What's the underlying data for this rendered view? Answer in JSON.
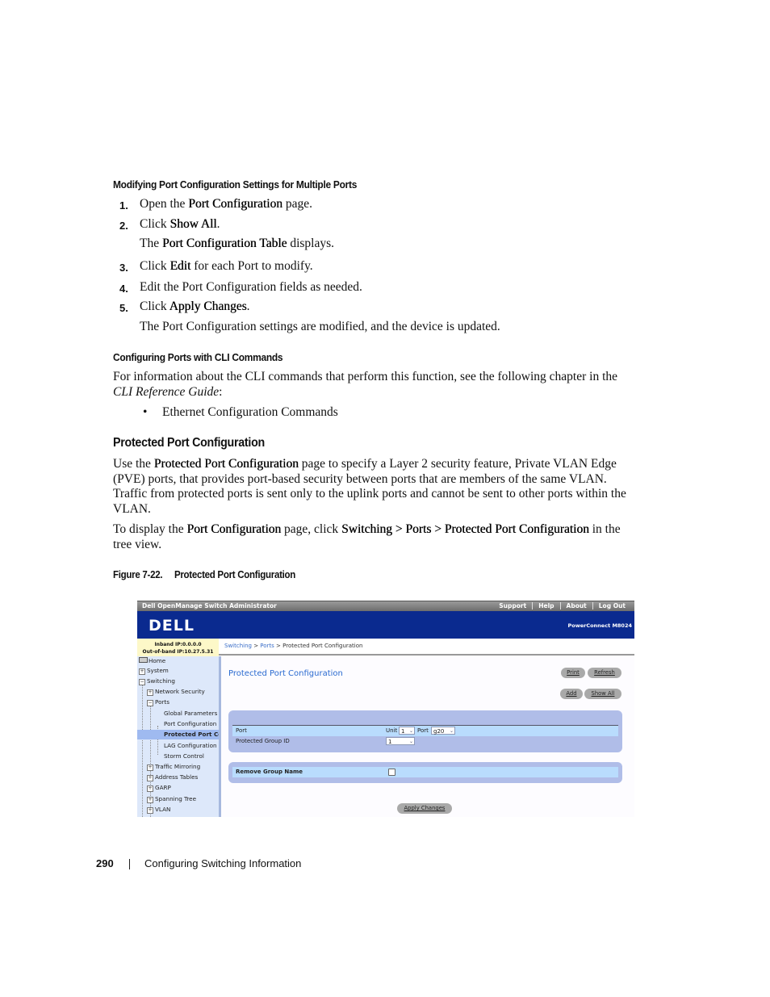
{
  "section1": {
    "heading": "Modifying Port Configuration Settings for Multiple Ports",
    "steps": [
      {
        "num": "1.",
        "pre": "Open the ",
        "bold": "Port Configuration",
        "post": " page."
      },
      {
        "num": "2.",
        "pre": "Click ",
        "bold": "Show All",
        "post": "."
      },
      {
        "num": "",
        "pre": "The ",
        "bold": "Port Configuration Table",
        "post": " displays."
      },
      {
        "num": "3.",
        "pre": "Click ",
        "bold": "Edit",
        "post": " for each Port to modify."
      },
      {
        "num": "4.",
        "pre": "Edit the Port Configuration fields as needed.",
        "bold": "",
        "post": ""
      },
      {
        "num": "5.",
        "pre": "Click ",
        "bold": "Apply Changes",
        "post": "."
      },
      {
        "num": "",
        "pre": "The Port Configuration settings are modified, and the device is updated.",
        "bold": "",
        "post": ""
      }
    ]
  },
  "section2": {
    "heading": "Configuring Ports with CLI Commands",
    "para_line1": "For information about the CLI commands that perform this function, see the following chapter in the",
    "para_italic": "CLI Reference Guide",
    "para_end": ":",
    "bullet": "Ethernet Configuration Commands"
  },
  "section3": {
    "heading": "Protected Port Configuration",
    "p1_pre": "Use the ",
    "p1_bold": "Protected Port Configuration",
    "p1_line1_post": " page to specify a Layer 2 security feature, Private VLAN Edge",
    "p1_line2": "(PVE) ports, that provides port-based security between ports that are members of the same VLAN.",
    "p1_line3": "Traffic from protected ports is sent only to the uplink ports and cannot be sent to other ports within the",
    "p1_line4": "VLAN.",
    "p2_pre": "To display the ",
    "p2_bold1": "Port Configuration",
    "p2_mid": " page, click ",
    "p2_bold2": "Switching > Ports > Protected Port Configuration",
    "p2_post": " in the",
    "p2_line2": "tree view.",
    "figure_label": "Figure 7-22.",
    "figure_title": "Protected Port Configuration"
  },
  "screenshot": {
    "app_title": "Dell OpenManage Switch Administrator",
    "top_links": [
      "Support",
      "Help",
      "About",
      "Log Out"
    ],
    "logo": "DELL",
    "product": "PowerConnect M8024",
    "inband_ip": "Inband IP:0.0.0.0",
    "oob_ip": "Out-of-band IP:10.27.5.31",
    "breadcrumb": {
      "link1": "Switching",
      "sep": " > ",
      "link2": "Ports",
      "current": "Protected Port Configuration"
    },
    "tree": [
      {
        "label": "Home",
        "icon": "home-icon"
      },
      {
        "label": "System",
        "icon": "expand-icon"
      },
      {
        "label": "Switching",
        "icon": "collapse-icon"
      },
      {
        "label": "Network Security",
        "icon": "expand-icon"
      },
      {
        "label": "Ports",
        "icon": "collapse-icon"
      },
      {
        "label": "Global Parameters",
        "icon": ""
      },
      {
        "label": "Port Configuration",
        "icon": ""
      },
      {
        "label": "Protected Port Co",
        "icon": "",
        "selected": true
      },
      {
        "label": "LAG Configuration",
        "icon": ""
      },
      {
        "label": "Storm Control",
        "icon": ""
      },
      {
        "label": "Traffic Mirroring",
        "icon": "expand-icon"
      },
      {
        "label": "Address Tables",
        "icon": "expand-icon"
      },
      {
        "label": "GARP",
        "icon": "expand-icon"
      },
      {
        "label": "Spanning Tree",
        "icon": "expand-icon"
      },
      {
        "label": "VLAN",
        "icon": "expand-icon"
      }
    ],
    "page_title": "Protected Port Configuration",
    "buttons": {
      "print": "Print",
      "refresh": "Refresh",
      "add": "Add",
      "show_all": "Show All",
      "apply": "Apply Changes"
    },
    "form": {
      "port_label": "Port",
      "unit_label": "Unit",
      "unit_value": "1",
      "port_sub_label": "Port",
      "port_value": "g20",
      "group_id_label": "Protected Group ID",
      "group_id_value": "1",
      "remove_group_label": "Remove Group Name",
      "remove_group_checked": false
    },
    "colors": {
      "banner": "#0a2a8f",
      "title_link": "#2a6ad0",
      "panel": "#b0bde8",
      "row_highlight": "#b9dcfd"
    }
  },
  "footer": {
    "page_number": "290",
    "chapter": "Configuring Switching Information"
  }
}
